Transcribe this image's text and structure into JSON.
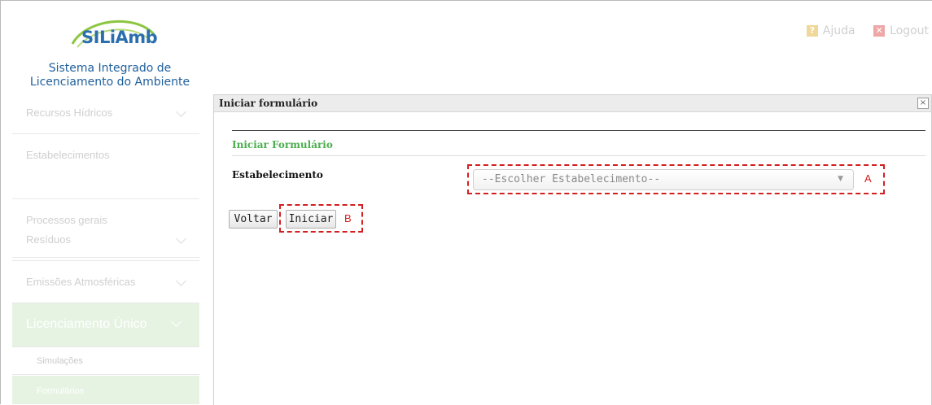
{
  "header": {
    "logo_text": "SILiAmb",
    "logo_subtitle_line1": "Sistema Integrado de",
    "logo_subtitle_line2": "Licenciamento do Ambiente",
    "help_label": "Ajuda",
    "logout_label": "Logout"
  },
  "sidebar": {
    "items": [
      {
        "label": "Recursos Hídricos"
      },
      {
        "label": "Estabelecimentos"
      },
      {
        "label": "Processos gerais"
      },
      {
        "label": "Resíduos"
      },
      {
        "label": "Emissões Atmosféricas"
      },
      {
        "label": "Licenciamento Único"
      },
      {
        "label": "Simulações"
      },
      {
        "label": "Formulários"
      }
    ]
  },
  "dialog": {
    "title": "Iniciar formulário",
    "close_glyph": "×",
    "section_title": "Iniciar Formulário",
    "field_label": "Estabelecimento",
    "select_placeholder": "--Escolher Estabelecimento--",
    "select_arrow": "▼",
    "back_button": "Voltar",
    "start_button": "Iniciar"
  },
  "annotations": {
    "a": "A",
    "b": "B"
  },
  "colors": {
    "accent_green": "#4caf50",
    "callout_red": "#d21f1f",
    "active_nav_bg": "#e6f3e2",
    "logo_blue": "#2b6fae"
  }
}
